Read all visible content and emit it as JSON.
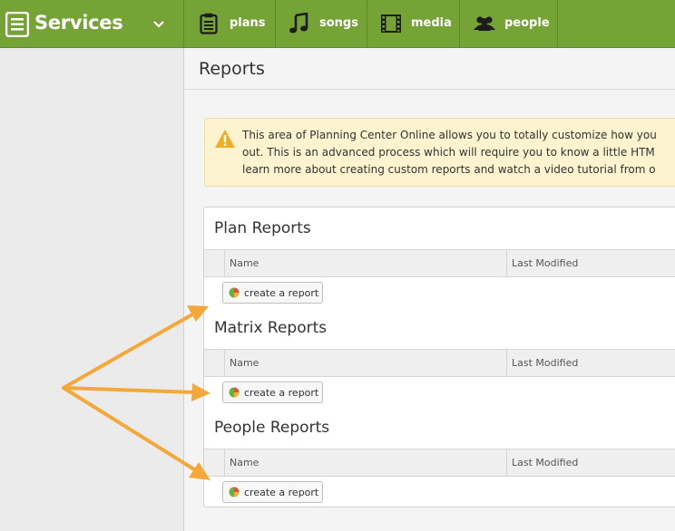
{
  "app": {
    "name": "Services",
    "icon": "services-logo-icon",
    "menu_icon": "chevron-down-icon"
  },
  "nav": {
    "tabs": [
      {
        "label": "plans",
        "icon": "clipboard-icon"
      },
      {
        "label": "songs",
        "icon": "music-note-icon"
      },
      {
        "label": "media",
        "icon": "film-icon"
      },
      {
        "label": "people",
        "icon": "people-icon"
      }
    ]
  },
  "page": {
    "title": "Reports"
  },
  "notice": {
    "icon": "warning-icon",
    "lines": [
      "This area of Planning Center Online allows you to totally customize how you",
      "out. This is an advanced process which will require you to know a little HTM",
      "learn more about creating custom reports and watch a video tutorial from o"
    ]
  },
  "sections": [
    {
      "title": "Plan Reports",
      "col_name": "Name",
      "col_modified": "Last Modified",
      "button": "create a report"
    },
    {
      "title": "Matrix Reports",
      "col_name": "Name",
      "col_modified": "Last Modified",
      "button": "create a report"
    },
    {
      "title": "People Reports",
      "col_name": "Name",
      "col_modified": "Last Modified",
      "button": "create a report"
    }
  ],
  "colors": {
    "brand_green": "#76a336",
    "annotation_arrow": "#f5a83a",
    "notice_bg": "#fdf3cf"
  }
}
